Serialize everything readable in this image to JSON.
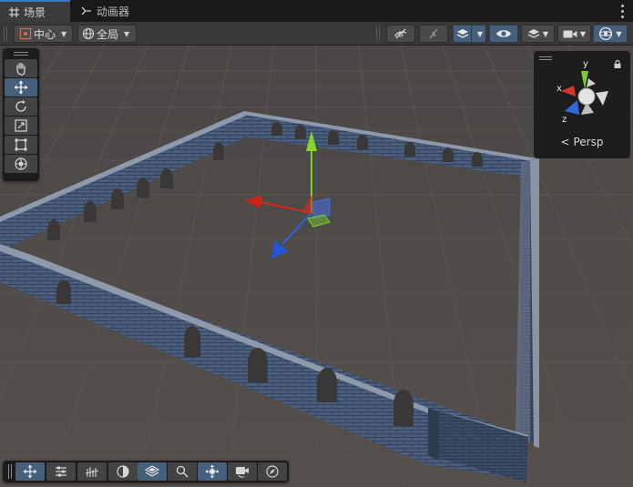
{
  "tabs": [
    {
      "label": "场景",
      "icon": "grid-icon",
      "active": true
    },
    {
      "label": "动画器",
      "icon": "animator-icon",
      "active": false
    }
  ],
  "toolbar": {
    "pivot_label": "中心",
    "space_label": "全局",
    "accent": "#46607c",
    "buttons": [
      "visibility-toggle-icon",
      "pick-toggle-icon",
      "grid-snap-icon",
      "draw-mode-icon",
      "layers-icon",
      "camera-icon",
      "gizmos-icon"
    ]
  },
  "tools": [
    "hand-tool-icon",
    "move-tool-icon",
    "rotate-tool-icon",
    "scale-tool-icon",
    "rect-tool-icon",
    "transform-tool-icon"
  ],
  "orientation": {
    "view_label": "Persp",
    "axis_x": "x",
    "axis_y": "y",
    "axis_z": "z",
    "colors": {
      "x": "#d4362c",
      "y": "#7ec92d",
      "z": "#3468d8"
    }
  },
  "overlay_buttons": [
    "move-overlay-icon",
    "sliders-icon",
    "particles-icon",
    "lighting-icon",
    "layers-overlay-icon",
    "search-overlay-icon",
    "nav-overlay-icon",
    "camera-overlay-icon",
    "compass-icon"
  ],
  "scene": {
    "object": "stone brick wall enclosure"
  }
}
